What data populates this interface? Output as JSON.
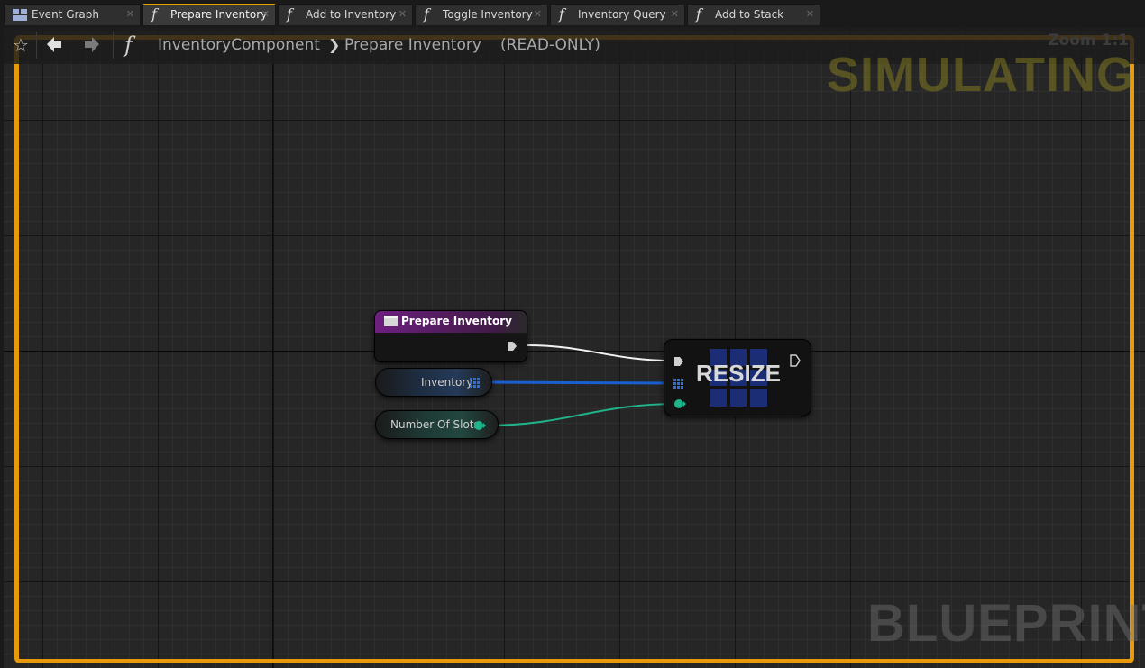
{
  "tabs": [
    {
      "label": "Event Graph",
      "icon": "event-graph-icon"
    },
    {
      "label": "Prepare Inventory",
      "icon": "function-icon"
    },
    {
      "label": "Add to Inventory",
      "icon": "function-icon"
    },
    {
      "label": "Toggle Inventory",
      "icon": "function-icon"
    },
    {
      "label": "Inventory Query",
      "icon": "function-icon"
    },
    {
      "label": "Add to Stack",
      "icon": "function-icon"
    }
  ],
  "header": {
    "breadcrumb_parent": "InventoryComponent",
    "breadcrumb_current": "Prepare Inventory",
    "read_only": "(READ-ONLY)",
    "zoom": "Zoom 1:1"
  },
  "watermarks": {
    "simulating": "SIMULATING",
    "blueprint": "BLUEPRINT"
  },
  "nodes": {
    "function_entry": {
      "title": "Prepare Inventory"
    },
    "inventory_var": {
      "label": "Inventory"
    },
    "slots_var": {
      "label": "Number Of Slots"
    },
    "resize": {
      "title": "RESIZE"
    }
  },
  "colors": {
    "simulating_border": "#e89a0c",
    "exec_wire": "#ffffff",
    "array_wire": "#1a5fd0",
    "int_wire": "#21b38a",
    "function_header": "#6d1f7e"
  }
}
